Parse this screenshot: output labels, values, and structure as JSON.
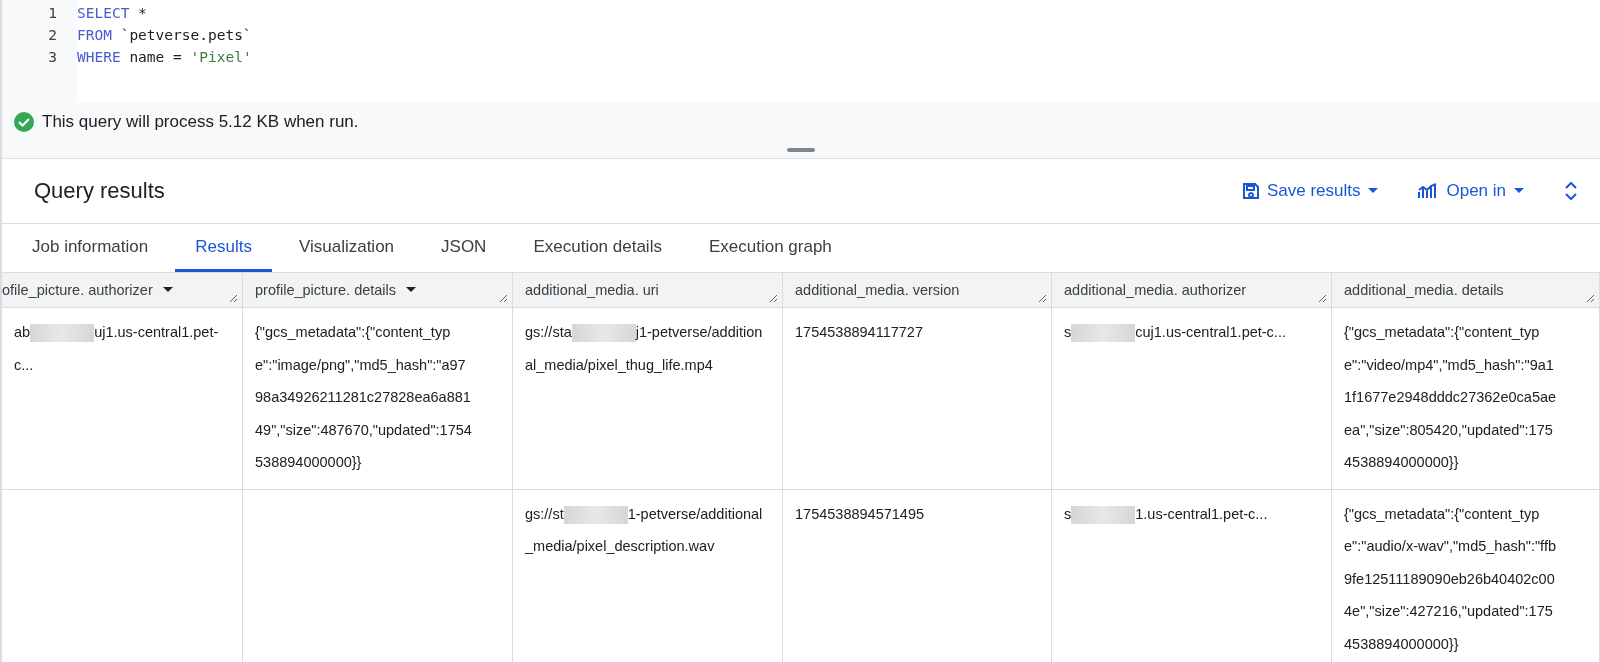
{
  "editor": {
    "lines": [
      {
        "number": "1",
        "tokens": [
          {
            "kind": "keyword",
            "text": "SELECT"
          },
          {
            "kind": "plain",
            "text": " *"
          }
        ]
      },
      {
        "number": "2",
        "tokens": [
          {
            "kind": "keyword",
            "text": "FROM"
          },
          {
            "kind": "plain",
            "text": " `petverse.pets`"
          }
        ]
      },
      {
        "number": "3",
        "tokens": [
          {
            "kind": "keyword",
            "text": "WHERE"
          },
          {
            "kind": "plain",
            "text": " name = "
          },
          {
            "kind": "string",
            "text": "'Pixel'"
          }
        ]
      }
    ]
  },
  "validation": {
    "message": "This query will process 5.12 KB when run."
  },
  "results": {
    "title": "Query results",
    "actions": [
      {
        "label": "Save results",
        "kind": "save"
      },
      {
        "label": "Open in",
        "kind": "chart"
      }
    ],
    "tabs": [
      {
        "label": "Job information",
        "selected": false
      },
      {
        "label": "Results",
        "selected": true
      },
      {
        "label": "Visualization",
        "selected": false
      },
      {
        "label": "JSON",
        "selected": false
      },
      {
        "label": "Execution details",
        "selected": false
      },
      {
        "label": "Execution graph",
        "selected": false
      }
    ],
    "table": {
      "columns": [
        {
          "label": "ofile_picture. authorizer",
          "sortable": true
        },
        {
          "label": "profile_picture. details",
          "sortable": true
        },
        {
          "label": "additional_media. uri",
          "sortable": false
        },
        {
          "label": "additional_media. version",
          "sortable": false
        },
        {
          "label": "additional_media. authorizer",
          "sortable": false
        },
        {
          "label": "additional_media. details",
          "sortable": false
        }
      ],
      "rows": [
        [
          {
            "before": "ab",
            "redacted": true,
            "after": "uj1.us-central1.pet-c..."
          },
          {
            "text": "{\"gcs_metadata\":{\"content_type\":\"image/png\",\"md5_hash\":\"a9798a34926211281c27828ea6a88149\",\"size\":487670,\"updated\":1754538894000000}}"
          },
          {
            "before": "gs://sta",
            "redacted": true,
            "after": "j1-petverse/additional_media/pixel_thug_life.mp4"
          },
          {
            "text": "1754538894117727"
          },
          {
            "before": "s",
            "redacted": true,
            "after": "cuj1.us-central1.pet-c..."
          },
          {
            "text": "{\"gcs_metadata\":{\"content_type\":\"video/mp4\",\"md5_hash\":\"9a11f1677e2948dddc27362e0ca5aeea\",\"size\":805420,\"updated\":1754538894000000}}"
          }
        ],
        [
          {},
          {},
          {
            "before": "gs://st",
            "redacted": true,
            "after": "1-petverse/additional_media/pixel_description.wav"
          },
          {
            "text": "1754538894571495"
          },
          {
            "before": "s",
            "redacted": true,
            "after": "1.us-central1.pet-c..."
          },
          {
            "text": "{\"gcs_metadata\":{\"content_type\":\"audio/x-wav\",\"md5_hash\":\"ffb9fe12511189090eb26b40402c004e\",\"size\":427216,\"updated\":1754538894000000}}"
          }
        ]
      ]
    }
  }
}
